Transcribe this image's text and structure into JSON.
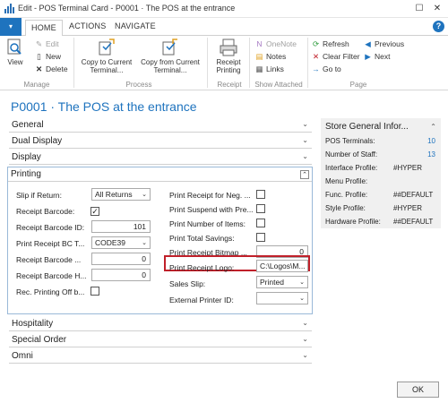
{
  "window": {
    "title": "Edit - POS Terminal Card - P0001 · The POS at the entrance",
    "maximize_glyph": "☐",
    "close_glyph": "✕"
  },
  "ribbon_tabs": {
    "app_button_glyph": "▾",
    "tabs": [
      "HOME",
      "ACTIONS",
      "NAVIGATE"
    ],
    "help_glyph": "?"
  },
  "ribbon": {
    "manage": {
      "label": "Manage",
      "view": "View",
      "edit": "Edit",
      "new": "New",
      "delete": "Delete"
    },
    "process": {
      "label": "Process",
      "copy_to_line1": "Copy to Current",
      "copy_to_line2": "Terminal...",
      "copy_from_line1": "Copy from Current",
      "copy_from_line2": "Terminal..."
    },
    "receipt": {
      "label": "Receipt",
      "receipt_printing_line1": "Receipt",
      "receipt_printing_line2": "Printing"
    },
    "show_attached": {
      "label": "Show Attached",
      "onenote": "OneNote",
      "notes": "Notes",
      "links": "Links"
    },
    "page": {
      "label": "Page",
      "refresh": "Refresh",
      "clear_filter": "Clear Filter",
      "go_to": "Go to",
      "previous": "Previous",
      "next": "Next"
    }
  },
  "page_title": "P0001 · The POS at the entrance",
  "fasttabs": {
    "general": "General",
    "dual_display": "Dual Display",
    "display": "Display",
    "printing": "Printing",
    "hospitality": "Hospitality",
    "special_order": "Special Order",
    "omni": "Omni"
  },
  "printing": {
    "slip_if_return": {
      "label": "Slip if Return:",
      "value": "All Returns"
    },
    "receipt_barcode": {
      "label": "Receipt Barcode:",
      "checked": true
    },
    "receipt_barcode_id": {
      "label": "Receipt Barcode ID:",
      "value": "101"
    },
    "print_receipt_bc": {
      "label": "Print Receipt BC T...",
      "value": "CODE39"
    },
    "receipt_barcode_x": {
      "label": "Receipt Barcode ...",
      "value": "0"
    },
    "receipt_barcode_h": {
      "label": "Receipt Barcode H...",
      "value": "0"
    },
    "rec_printing_off": {
      "label": "Rec. Printing Off b...",
      "checked": false
    },
    "print_receipt_neg": {
      "label": "Print Receipt for Neg. ...",
      "checked": false
    },
    "print_suspend": {
      "label": "Print Suspend with Pre...",
      "checked": false
    },
    "print_number_items": {
      "label": "Print Number of Items:",
      "checked": false
    },
    "print_total_savings": {
      "label": "Print Total Savings:",
      "checked": false
    },
    "print_receipt_bitmap": {
      "label": "Print Receipt Bitmap ...",
      "value": "0"
    },
    "print_receipt_logo": {
      "label": "Print Receipt Logo:",
      "value": "C:\\Logos\\M..."
    },
    "sales_slip": {
      "label": "Sales Slip:",
      "value": "Printed"
    },
    "external_printer_id": {
      "label": "External Printer ID:",
      "value": ""
    },
    "checkmark_glyph": "✓"
  },
  "factbox": {
    "title": "Store General Infor...",
    "rows": [
      {
        "label": "POS Terminals:",
        "value": "10"
      },
      {
        "label": "Number of Staff:",
        "value": "13"
      },
      {
        "label": "Interface Profile:",
        "value": "#HYPER"
      },
      {
        "label": "Menu Profile:",
        "value": ""
      },
      {
        "label": "Func. Profile:",
        "value": "##DEFAULT"
      },
      {
        "label": "Style Profile:",
        "value": "#HYPER"
      },
      {
        "label": "Hardware Profile:",
        "value": "##DEFAULT"
      }
    ]
  },
  "ok_button": "OK",
  "colors": {
    "accent": "#1e73be",
    "highlight_border": "#c0202a",
    "factbox_bg": "#f0f0f0"
  },
  "icons": [
    "app-icon",
    "view-icon",
    "edit-icon",
    "new-icon",
    "delete-icon",
    "copy-to-icon",
    "copy-from-icon",
    "receipt-printing-icon",
    "onenote-icon",
    "notes-icon",
    "links-icon",
    "refresh-icon",
    "clear-filter-icon",
    "go-to-icon",
    "previous-icon",
    "next-icon",
    "help-icon"
  ]
}
